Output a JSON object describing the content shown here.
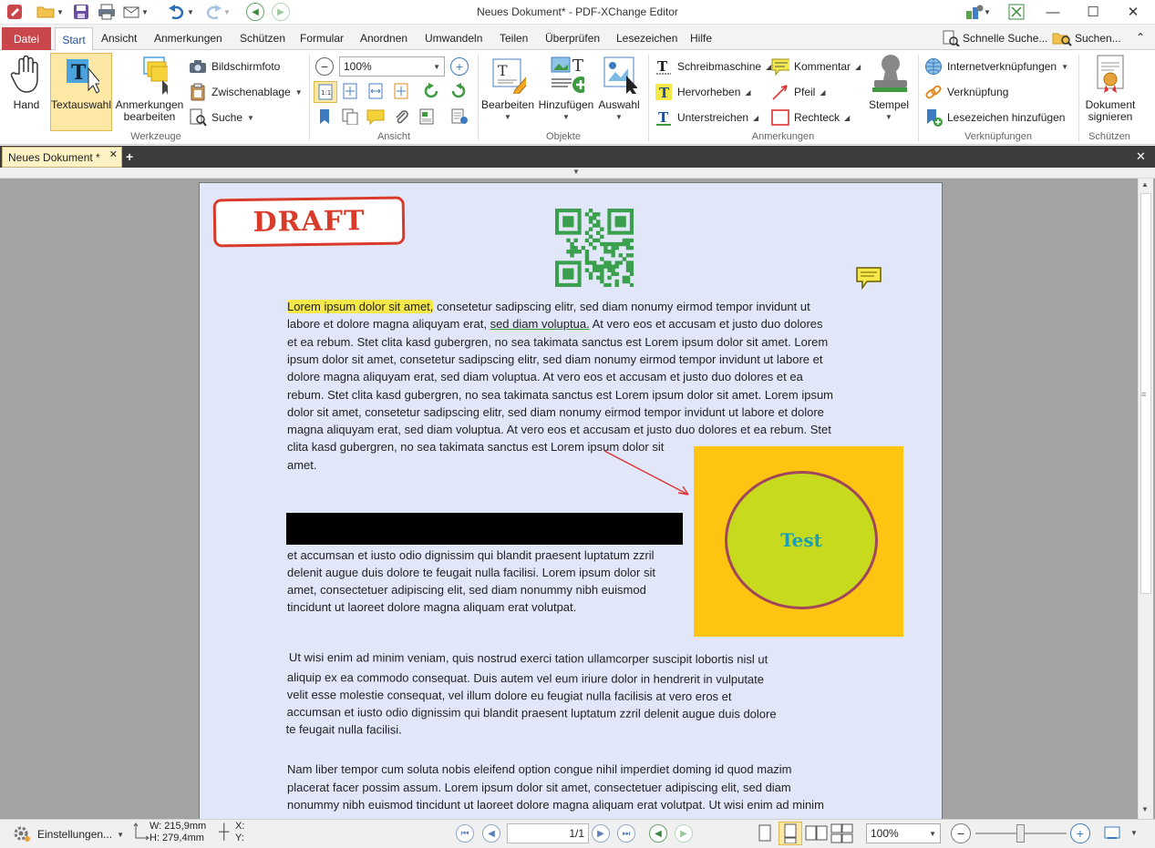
{
  "window": {
    "title": "Neues Dokument* - PDF-XChange Editor"
  },
  "menu": {
    "file": "Datei",
    "tabs": [
      "Start",
      "Ansicht",
      "Anmerkungen",
      "Schützen",
      "Formular",
      "Anordnen",
      "Umwandeln",
      "Teilen",
      "Überprüfen",
      "Lesezeichen",
      "Hilfe"
    ],
    "quick_search": "Schnelle Suche...",
    "search": "Suchen..."
  },
  "ribbon": {
    "werkzeuge": {
      "label": "Werkzeuge",
      "hand": "Hand",
      "textauswahl": "Textauswahl",
      "anmerkungen_line1": "Anmerkungen",
      "anmerkungen_line2": "bearbeiten",
      "bildschirmfoto": "Bildschirmfoto",
      "zwischenablage": "Zwischenablage",
      "suche": "Suche"
    },
    "ansicht": {
      "label": "Ansicht",
      "zoom": "100%"
    },
    "objekte": {
      "label": "Objekte",
      "bearbeiten": "Bearbeiten",
      "hinzufuegen": "Hinzufügen",
      "auswahl": "Auswahl"
    },
    "anmerkungen": {
      "label": "Anmerkungen",
      "schreibmaschine": "Schreibmaschine",
      "hervorheben": "Hervorheben",
      "unterstreichen": "Unterstreichen",
      "kommentar": "Kommentar",
      "pfeil": "Pfeil",
      "rechteck": "Rechteck",
      "stempel": "Stempel"
    },
    "verknuepfungen": {
      "label": "Verknüpfungen",
      "internet": "Internetverknüpfungen",
      "verknuepfung": "Verknüpfung",
      "lesezeichen": "Lesezeichen hinzufügen"
    },
    "schuetzen": {
      "label": "Schützen",
      "dok_line1": "Dokument",
      "dok_line2": "signieren"
    }
  },
  "doc_tab": {
    "label": "Neues Dokument *"
  },
  "page": {
    "stamp": "DRAFT",
    "shape_text": "Test",
    "p1": {
      "highlight": "Lorem ipsum dolor sit amet,",
      "l1_rest": " consetetur sadipscing elitr, sed diam nonumy eirmod tempor invidunt ut",
      "l2_a": "labore et dolore magna aliquyam erat, ",
      "l2_u": "sed diam voluptua.",
      "l2_b": " At vero eos et accusam et justo duo dolores",
      "lines": [
        "et ea rebum. Stet clita kasd gubergren, no sea takimata sanctus est Lorem ipsum dolor sit amet. Lorem",
        "ipsum dolor sit amet, consetetur sadipscing elitr, sed diam nonumy eirmod tempor invidunt ut labore et",
        "dolore magna aliquyam erat, sed diam voluptua. At vero eos et accusam et justo duo dolores et ea",
        "rebum. Stet clita kasd gubergren, no sea takimata sanctus est Lorem ipsum dolor sit amet. Lorem ipsum",
        "dolor sit amet, consetetur sadipscing elitr, sed diam nonumy eirmod tempor invidunt ut labore et dolore",
        "magna aliquyam erat, sed diam voluptua. At vero eos et accusam et justo duo dolores et ea rebum. Stet",
        "clita kasd gubergren, no sea takimata sanctus est Lorem ipsum dolor sit",
        "amet."
      ]
    },
    "p2": [
      "et accumsan et iusto odio dignissim qui blandit praesent luptatum zzril",
      "delenit augue duis dolore te feugait nulla facilisi. Lorem ipsum dolor sit",
      "amet, consectetuer adipiscing elit, sed diam nonummy nibh euismod",
      "tincidunt ut laoreet dolore magna aliquam erat volutpat."
    ],
    "p3": [
      "Ut wisi enim ad minim veniam, quis nostrud exerci tation ullamcorper suscipit lobortis nisl ut",
      "aliquip ex ea commodo consequat. Duis autem vel eum iriure dolor in hendrerit in vulputate",
      "velit esse molestie consequat, vel illum dolore eu feugiat nulla facilisis at vero eros et",
      "accumsan et iusto odio dignissim qui blandit praesent luptatum zzril delenit augue duis dolore",
      "te feugait nulla facilisi."
    ],
    "p4": [
      "Nam liber tempor cum soluta nobis eleifend option congue nihil imperdiet doming id quod mazim",
      "placerat facer possim assum. Lorem ipsum dolor sit amet, consectetuer adipiscing elit, sed diam",
      "nonummy nibh euismod tincidunt ut laoreet dolore magna aliquam erat volutpat. Ut wisi enim ad minim"
    ]
  },
  "status": {
    "settings": "Einstellungen...",
    "width": "W: 215,9mm",
    "height": "H: 279,4mm",
    "x_label": "X:",
    "y_label": "Y:",
    "page_indicator": "1/1",
    "zoom": "100%"
  },
  "colors": {
    "accent": "#1f4e9a",
    "file_tab": "#c9474b",
    "doc_tab": "#fdf2c4",
    "page": "#e2e6f9",
    "highlight": "#f5e94a",
    "rect_fill": "#fdc512",
    "ellipse_fill": "#c8da1e",
    "stamp": "#d93b2b"
  }
}
